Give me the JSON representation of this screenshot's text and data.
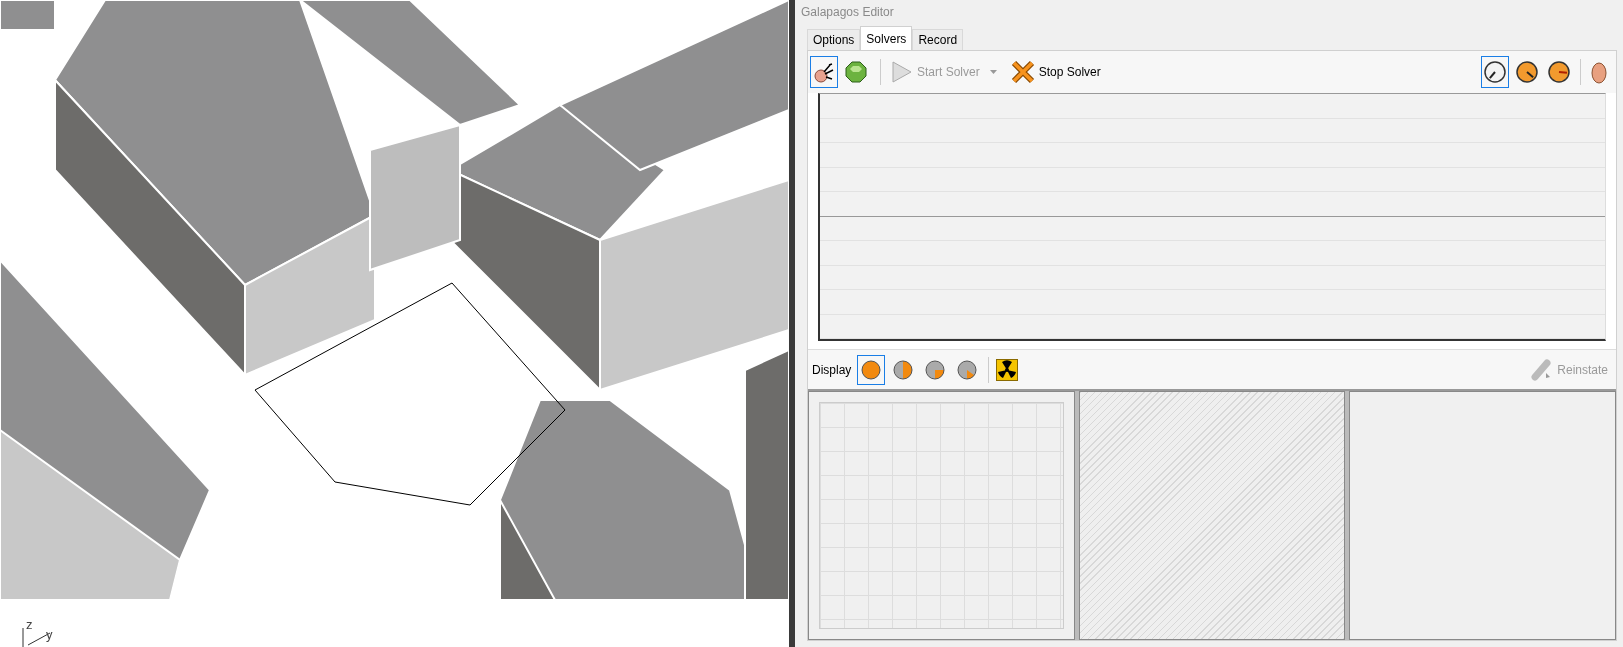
{
  "viewport": {
    "axis_labels": [
      "z",
      "y"
    ]
  },
  "editor": {
    "title": "Galapagos Editor",
    "tabs": [
      {
        "label": "Options",
        "selected": false
      },
      {
        "label": "Solvers",
        "selected": true
      },
      {
        "label": "Record",
        "selected": false
      }
    ],
    "solver_types": [
      {
        "kind": "evolutionary",
        "selected": true
      },
      {
        "kind": "annealing",
        "selected": false
      }
    ],
    "start_solver": {
      "label": "Start Solver",
      "disabled": true
    },
    "stop_solver": {
      "label": "Stop Solver",
      "disabled": false
    },
    "speeds": [
      {
        "kind": "slow",
        "selected": true
      },
      {
        "kind": "medium",
        "selected": false
      },
      {
        "kind": "fast",
        "selected": false
      }
    ],
    "display": {
      "label": "Display",
      "modes": [
        {
          "kind": "full",
          "selected": true
        },
        {
          "kind": "half",
          "selected": false
        },
        {
          "kind": "quarter",
          "selected": false
        },
        {
          "kind": "eighth",
          "selected": false
        }
      ]
    },
    "reinstate": {
      "label": "Reinstate",
      "disabled": true
    }
  }
}
